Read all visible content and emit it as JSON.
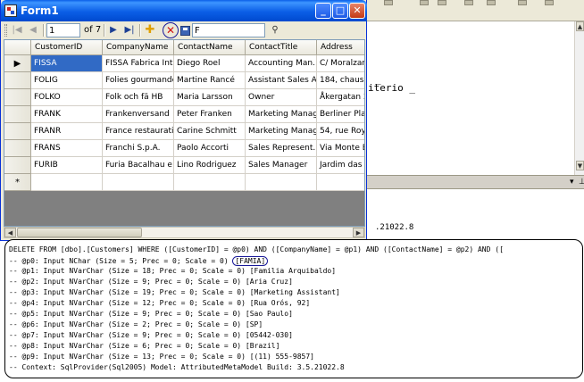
{
  "window": {
    "title": "Form1",
    "minimize_label": "_",
    "maximize_label": "□",
    "close_label": "✕"
  },
  "navigator": {
    "first_icon": "first-record-icon",
    "prev_icon": "previous-record-icon",
    "position_value": "1",
    "count_label": "of 7",
    "next_icon": "next-record-icon",
    "last_icon": "last-record-icon",
    "add_icon": "add-new-icon",
    "delete_icon": "delete-icon",
    "save_icon": "save-icon",
    "filter_value": "F",
    "search_icon": "binoculars-icon"
  },
  "grid": {
    "columns": [
      "CustomerID",
      "CompanyName",
      "ContactName",
      "ContactTitle",
      "Address"
    ],
    "rows": [
      [
        "FISSA",
        "FISSA Fabrica Int...",
        "Diego Roel",
        "Accounting Man...",
        "C/ Moralzarza"
      ],
      [
        "FOLIG",
        "Folies gourmandes",
        "Martine Rancé",
        "Assistant Sales A...",
        "184, chaussé"
      ],
      [
        "FOLKO",
        "Folk och fä HB",
        "Maria Larsson",
        "Owner",
        "Åkergatan 24"
      ],
      [
        "FRANK",
        "Frankenversand",
        "Peter Franken",
        "Marketing Manager",
        "Berliner Platz"
      ],
      [
        "FRANR",
        "France restauration",
        "Carine Schmitt",
        "Marketing Manager",
        "54, rue Royal"
      ],
      [
        "FRANS",
        "Franchi S.p.A.",
        "Paolo Accorti",
        "Sales Represent...",
        "Via Monte Bi"
      ],
      [
        "FURIB",
        "Furia Bacalhau e ...",
        "Lino Rodriguez",
        "Sales Manager",
        "Jardim das ro"
      ]
    ],
    "current_row_marker": "▶",
    "new_row_marker": "*"
  },
  "ide": {
    "code_line_1": "_",
    "code_line_2": "iterio _",
    "build_text": ".21022.8"
  },
  "sql": {
    "delete_statement": "DELETE FROM [dbo].[Customers] WHERE ([CustomerID] = @p0) AND ([CompanyName] = @p1) AND ([ContactName] = @p2) AND ([",
    "p0_prefix": "-- @p0: Input NChar (Size = 5; Prec = 0; Scale = 0) ",
    "p0_value": "[FAMIA]",
    "params": [
      "-- @p1: Input NVarChar (Size = 18; Prec = 0; Scale = 0) [Familia Arquibaldo]",
      "-- @p2: Input NVarChar (Size = 9; Prec = 0; Scale = 0) [Aria Cruz]",
      "-- @p3: Input NVarChar (Size = 19; Prec = 0; Scale = 0) [Marketing Assistant]",
      "-- @p4: Input NVarChar (Size = 12; Prec = 0; Scale = 0) [Rua Orós, 92]",
      "-- @p5: Input NVarChar (Size = 9; Prec = 0; Scale = 0) [Sao Paulo]",
      "-- @p6: Input NVarChar (Size = 2; Prec = 0; Scale = 0) [SP]",
      "-- @p7: Input NVarChar (Size = 9; Prec = 0; Scale = 0) [05442-030]",
      "-- @p8: Input NVarChar (Size = 6; Prec = 0; Scale = 0) [Brazil]",
      "-- @p9: Input NVarChar (Size = 13; Prec = 0; Scale = 0) [(11) 555-9857]"
    ],
    "context_line": "-- Context: SqlProvider(Sql2005) Model: AttributedMetaModel Build: 3.5.21022.8"
  }
}
